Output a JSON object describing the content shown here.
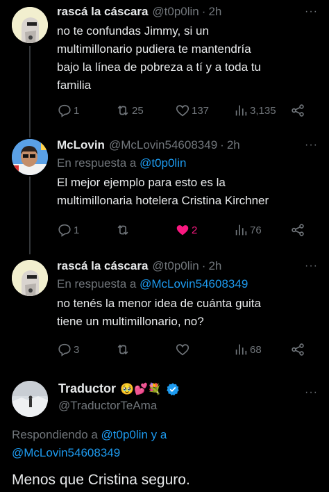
{
  "tweets": [
    {
      "name": "rascá la cáscara",
      "handle": "@t0p0lin",
      "time": "2h",
      "reply_prefix": "",
      "reply_target": "",
      "text_lines": [
        "no te confundas Jimmy, si un",
        "multimillonario pudiera te mantendría",
        "bajo la línea de pobreza a tí y a toda tu",
        "familia"
      ],
      "replies": "1",
      "retweets": "25",
      "likes": "137",
      "views": "3,135",
      "liked": false
    },
    {
      "name": "McLovin",
      "handle": "@McLovin54608349",
      "time": "2h",
      "reply_prefix": "En respuesta a ",
      "reply_target": "@t0p0lin",
      "text_lines": [
        "El mejor ejemplo para esto es la",
        "multimillonaria hotelera Cristina Kirchner"
      ],
      "replies": "1",
      "retweets": "",
      "likes": "2",
      "views": "76",
      "liked": true
    },
    {
      "name": "rascá la cáscara",
      "handle": "@t0p0lin",
      "time": "2h",
      "reply_prefix": "En respuesta a ",
      "reply_target": "@McLovin54608349",
      "text_lines": [
        "no tenés la menor idea de cuánta guita",
        "tiene un multimillonario, no?"
      ],
      "replies": "3",
      "retweets": "",
      "likes": "",
      "views": "68",
      "liked": false
    }
  ],
  "main_tweet": {
    "name": "Traductor",
    "name_emoji": "🥹💕💐",
    "handle": "@TraductorTeAma",
    "reply_prefix": "Respondiendo a ",
    "reply_target_1": "@t0p0lin",
    "reply_joiner": " y a",
    "reply_target_2": "@McLovin54608349",
    "text": "Menos que Cristina seguro."
  },
  "ui": {
    "separator_dot": "·",
    "more_glyph": "···"
  },
  "colors": {
    "background": "#000000",
    "text_primary": "#e7e9ea",
    "text_secondary": "#71767b",
    "link": "#1d9bf0",
    "like": "#f91880",
    "verified": "#1d9bf0"
  },
  "icons": [
    "reply-icon",
    "retweet-icon",
    "like-icon",
    "views-icon",
    "share-icon",
    "more-icon",
    "verified-icon"
  ]
}
